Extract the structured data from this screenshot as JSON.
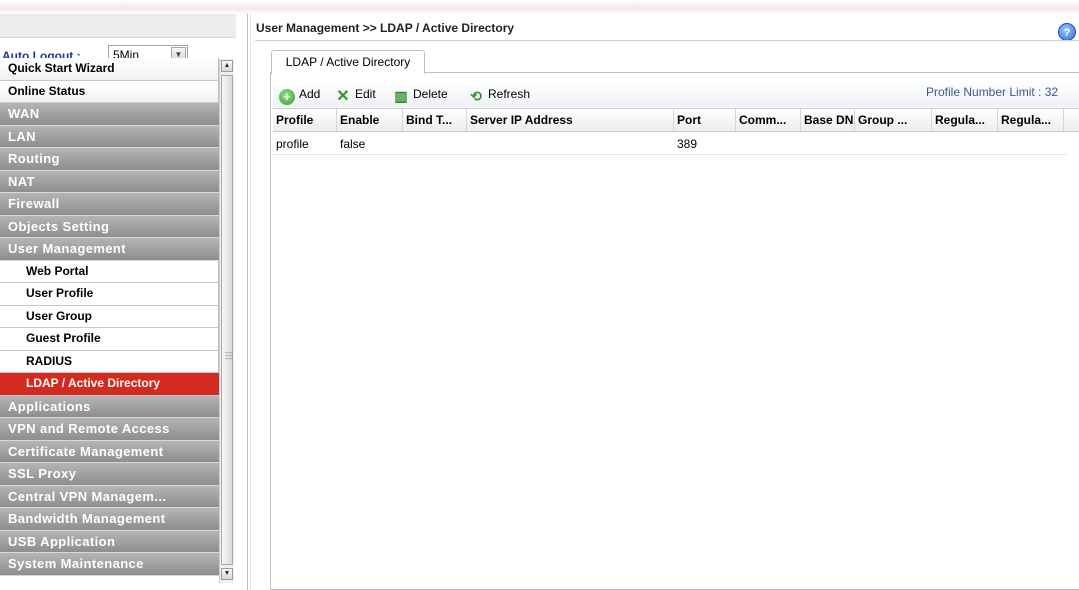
{
  "sidebar": {
    "auto_logout": {
      "label": "Auto Logout :",
      "value": "5Min"
    },
    "items": [
      {
        "label": "Quick Start Wizard",
        "style": "light"
      },
      {
        "label": "Online Status",
        "style": "light"
      },
      {
        "label": "WAN",
        "style": "dark"
      },
      {
        "label": "LAN",
        "style": "dark"
      },
      {
        "label": "Routing",
        "style": "dark"
      },
      {
        "label": "NAT",
        "style": "dark"
      },
      {
        "label": "Firewall",
        "style": "dark"
      },
      {
        "label": "Objects Setting",
        "style": "dark"
      },
      {
        "label": "User Management",
        "style": "dark"
      },
      {
        "label": "Web Portal",
        "style": "sub"
      },
      {
        "label": "User Profile",
        "style": "sub"
      },
      {
        "label": "User Group",
        "style": "sub"
      },
      {
        "label": "Guest Profile",
        "style": "sub"
      },
      {
        "label": "RADIUS",
        "style": "sub"
      },
      {
        "label": "LDAP / Active Directory",
        "style": "active"
      },
      {
        "label": "Applications",
        "style": "dark"
      },
      {
        "label": "VPN and Remote Access",
        "style": "dark"
      },
      {
        "label": "Certificate Management",
        "style": "dark"
      },
      {
        "label": "SSL Proxy",
        "style": "dark"
      },
      {
        "label": "Central VPN Managem...",
        "style": "dark"
      },
      {
        "label": "Bandwidth Management",
        "style": "dark"
      },
      {
        "label": "USB Application",
        "style": "dark"
      },
      {
        "label": "System Maintenance",
        "style": "dark"
      }
    ]
  },
  "main": {
    "breadcrumb": "User Management >> LDAP / Active Directory",
    "help_icon": "?",
    "tab": "LDAP / Active Directory",
    "toolbar": {
      "add": "Add",
      "edit": "Edit",
      "delete": "Delete",
      "refresh": "Refresh",
      "profile_limit": "Profile Number Limit : 32"
    },
    "table": {
      "columns": [
        "Profile",
        "Enable",
        "Bind T...",
        "Server IP Address",
        "Port",
        "Comm...",
        "Base DN",
        "Group ...",
        "Regula...",
        "Regula..."
      ],
      "rows": [
        [
          "profile",
          "false",
          "",
          "",
          "389",
          "",
          "",
          "",
          "",
          ""
        ]
      ]
    }
  },
  "colors": {
    "active_menu": "#d52a1f",
    "dark_menu": "#a0a0a0",
    "label_blue": "#1a3aa0",
    "icon_green": "#2f9a2a"
  }
}
